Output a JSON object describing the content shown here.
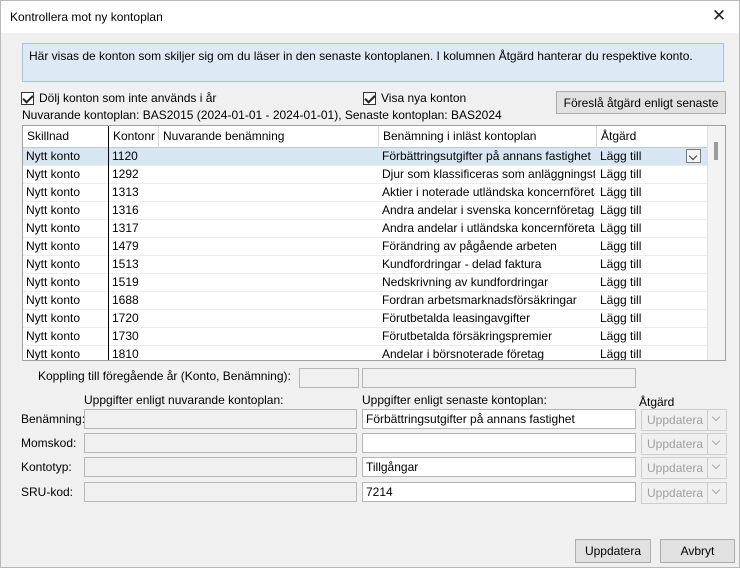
{
  "window": {
    "title": "Kontrollera mot ny kontoplan"
  },
  "info_text": "Här visas de konton som skiljer sig om du läser in den senaste kontoplanen. I kolumnen Åtgärd hanterar du respektive konto.",
  "options": {
    "hide_unused_label": "Dölj konton som inte används i år",
    "hide_unused_checked": true,
    "show_new_label": "Visa nya konton",
    "show_new_checked": true
  },
  "plans_text": "Nuvarande kontoplan: BAS2015 (2024-01-01 - 2024-01-01), Senaste kontoplan: BAS2024",
  "suggest_button": "Föreslå åtgärd enligt senaste",
  "grid": {
    "columns": [
      "Skillnad",
      "Kontonr",
      "Nuvarande benämning",
      "Benämning i inläst kontoplan",
      "Åtgärd"
    ],
    "rows": [
      {
        "diff": "Nytt konto",
        "nr": "1120",
        "cur": "",
        "new": "Förbättringsutgifter på annans fastighet",
        "action": "Lägg till"
      },
      {
        "diff": "Nytt konto",
        "nr": "1292",
        "cur": "",
        "new": "Djur som klassificeras som anläggningstillgång",
        "action": "Lägg till"
      },
      {
        "diff": "Nytt konto",
        "nr": "1313",
        "cur": "",
        "new": "Aktier i noterade utländska koncernföretag",
        "action": "Lägg till"
      },
      {
        "diff": "Nytt konto",
        "nr": "1316",
        "cur": "",
        "new": "Andra andelar i svenska koncernföretag",
        "action": "Lägg till"
      },
      {
        "diff": "Nytt konto",
        "nr": "1317",
        "cur": "",
        "new": "Andra andelar i utländska koncernföretag",
        "action": "Lägg till"
      },
      {
        "diff": "Nytt konto",
        "nr": "1479",
        "cur": "",
        "new": "Förändring av pågående arbeten",
        "action": "Lägg till"
      },
      {
        "diff": "Nytt konto",
        "nr": "1513",
        "cur": "",
        "new": "Kundfordringar - delad faktura",
        "action": "Lägg till"
      },
      {
        "diff": "Nytt konto",
        "nr": "1519",
        "cur": "",
        "new": "Nedskrivning av kundfordringar",
        "action": "Lägg till"
      },
      {
        "diff": "Nytt konto",
        "nr": "1688",
        "cur": "",
        "new": "Fordran arbetsmarknadsförsäkringar",
        "action": "Lägg till"
      },
      {
        "diff": "Nytt konto",
        "nr": "1720",
        "cur": "",
        "new": "Förutbetalda leasingavgifter",
        "action": "Lägg till"
      },
      {
        "diff": "Nytt konto",
        "nr": "1730",
        "cur": "",
        "new": "Förutbetalda försäkringspremier",
        "action": "Lägg till"
      },
      {
        "diff": "Nytt konto",
        "nr": "1810",
        "cur": "",
        "new": "Andelar i börsnoterade företag",
        "action": "Lägg till"
      }
    ]
  },
  "prev_year_label": "Koppling till föregående år (Konto, Benämning):",
  "details": {
    "current_header": "Uppgifter enligt nuvarande kontoplan:",
    "latest_header": "Uppgifter enligt senaste kontoplan:",
    "action_header": "Åtgärd",
    "rows": [
      {
        "label": "Benämning:",
        "current": "",
        "latest": "Förbättringsutgifter på annans fastighet",
        "action": "Uppdatera"
      },
      {
        "label": "Momskod:",
        "current": "",
        "latest": "",
        "action": "Uppdatera"
      },
      {
        "label": "Kontotyp:",
        "current": "",
        "latest": "Tillgångar",
        "action": "Uppdatera"
      },
      {
        "label": "SRU-kod:",
        "current": "",
        "latest": "7214",
        "action": "Uppdatera"
      }
    ]
  },
  "footer": {
    "update_button": "Uppdatera",
    "cancel_button": "Avbryt"
  }
}
